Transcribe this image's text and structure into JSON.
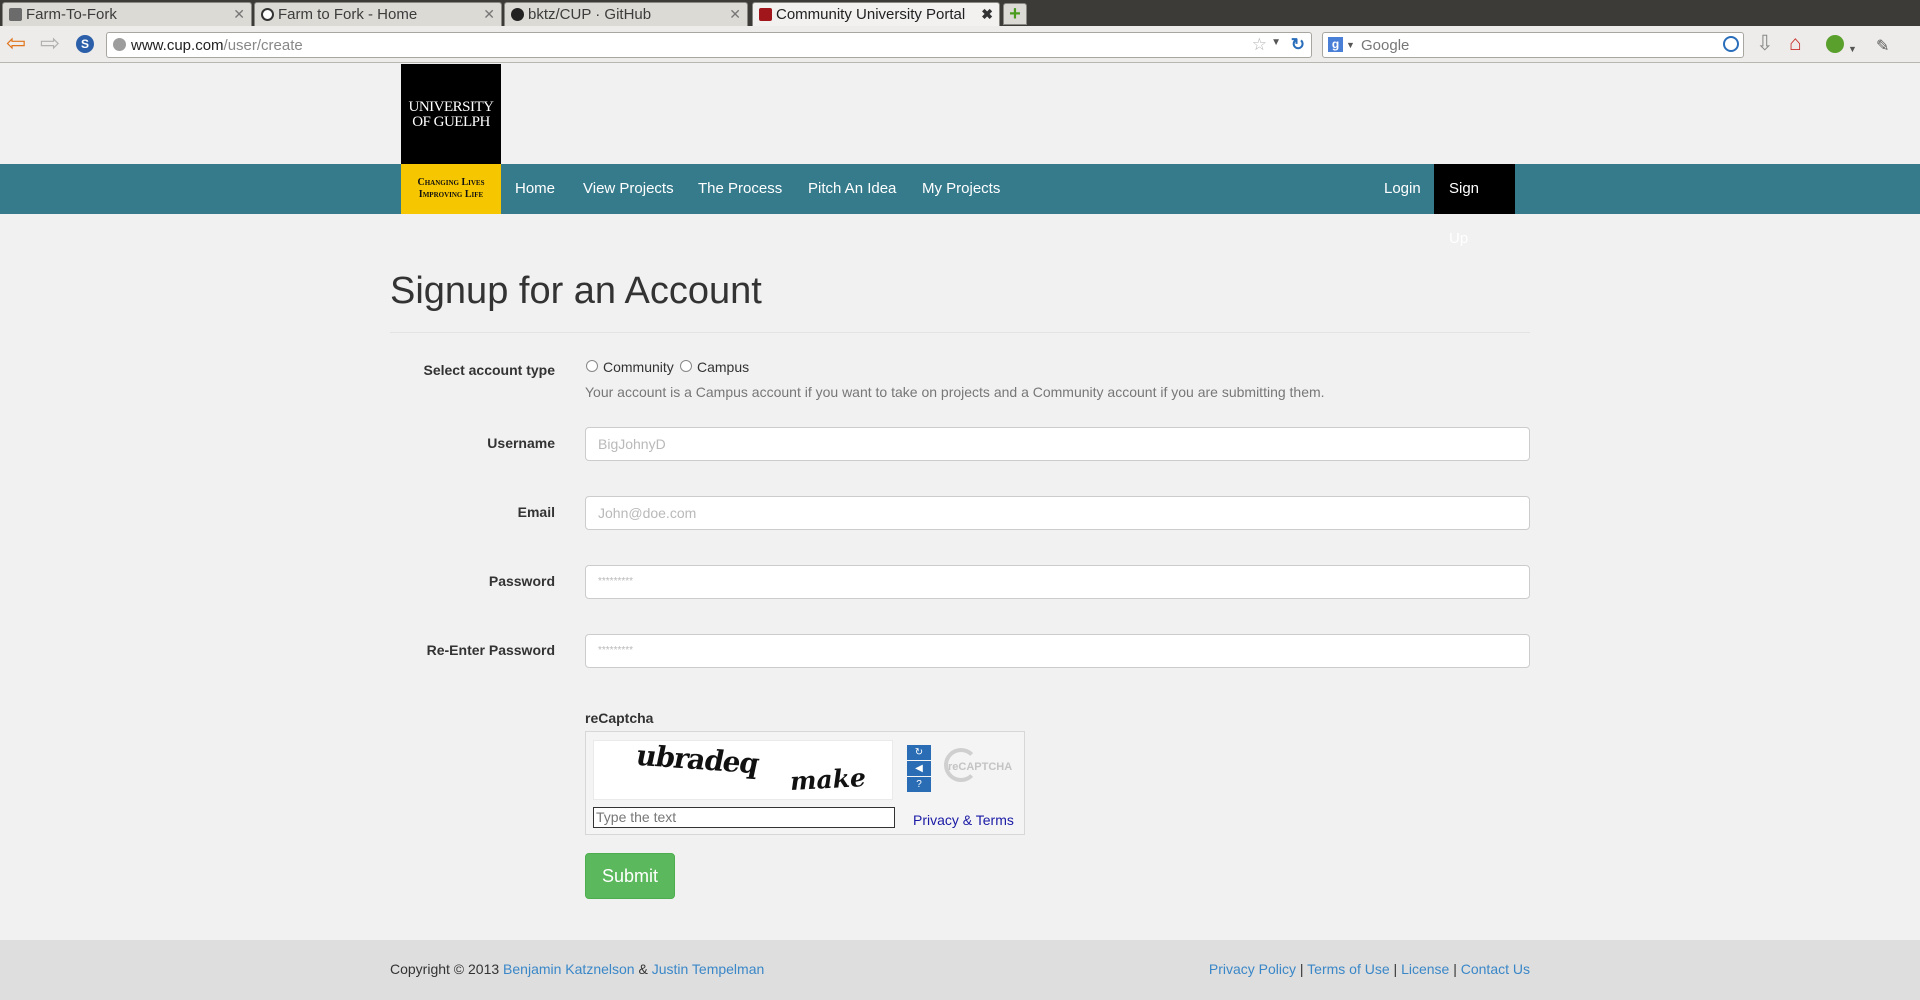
{
  "browser": {
    "tabs": [
      {
        "label": "Farm-To-Fork",
        "active": false
      },
      {
        "label": "Farm to Fork - Home",
        "active": false
      },
      {
        "label": "bktz/CUP · GitHub",
        "active": false
      },
      {
        "label": "Community University Portal",
        "active": true
      }
    ],
    "new_tab": "+",
    "url_host": "www.cup.com",
    "url_path": "/user/create",
    "search_engine_letter": "g",
    "search_placeholder": "Google"
  },
  "logo": {
    "line1": "University",
    "line2": "of Guelph",
    "tagline1": "Changing Lives",
    "tagline2": "Improving Life"
  },
  "nav": {
    "items": [
      "Home",
      "View Projects",
      "The Process",
      "Pitch An Idea",
      "My Projects"
    ],
    "login": "Login",
    "signup": "Sign Up"
  },
  "form": {
    "title": "Signup for an Account",
    "account_type_label": "Select account type",
    "account_options": [
      "Community",
      "Campus"
    ],
    "account_help": "Your account is a Campus account if you want to take on projects and a Community account if you are submitting them.",
    "username_label": "Username",
    "username_placeholder": "BigJohnyD",
    "email_label": "Email",
    "email_placeholder": "John@doe.com",
    "password_label": "Password",
    "password_placeholder": "*********",
    "reenter_label": "Re-Enter Password",
    "reenter_placeholder": "*********",
    "captcha_label": "reCaptcha",
    "captcha_word1": "ubradeq",
    "captcha_word2": "make",
    "captcha_input_placeholder": "Type the text",
    "captcha_logo_text": "reCAPTCHA",
    "captcha_privacy": "Privacy & Terms",
    "submit": "Submit"
  },
  "footer": {
    "copyright": "Copyright © 2013",
    "author1": "Benjamin Katznelson",
    "amp": "&",
    "author2": "Justin Tempelman",
    "links": [
      "Privacy Policy",
      "Terms of Use",
      "License",
      "Contact Us"
    ],
    "separator": "|"
  },
  "colors": {
    "nav_bg": "#367b8c",
    "submit_bg": "#5cb85c",
    "logo_yellow": "#f6c600",
    "link": "#3a87c8"
  }
}
